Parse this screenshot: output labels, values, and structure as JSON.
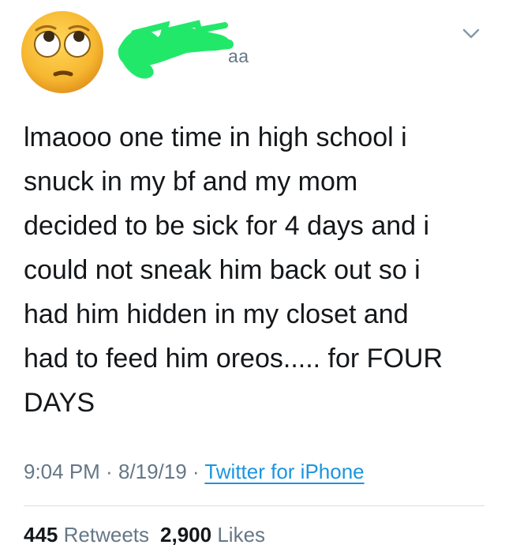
{
  "author": {
    "avatar_icon": "face-with-rolling-eyes-emoji-icon",
    "handle_fragment": "aa",
    "redaction_color": "#22e86a"
  },
  "tweet": {
    "text": "lmaooo one time in high school i\nsnuck in my bf and my mom\ndecided to be sick for 4 days and i\ncould not sneak him back out so i\nhad him hidden in my closet and\nhad to feed him oreos..... for FOUR\nDAYS",
    "time": "9:04 PM",
    "sep1": " · ",
    "date": "8/19/19",
    "sep2": " · ",
    "source": "Twitter for iPhone"
  },
  "stats": {
    "retweets_count": "445",
    "retweets_label": "Retweets",
    "likes_count": "2,900",
    "likes_label": "Likes"
  },
  "icons": {
    "menu": "chevron-down-icon"
  },
  "colors": {
    "text": "#14171a",
    "secondary": "#657786",
    "link": "#1b95e0",
    "emoji_yellow": "#f5b72e"
  }
}
